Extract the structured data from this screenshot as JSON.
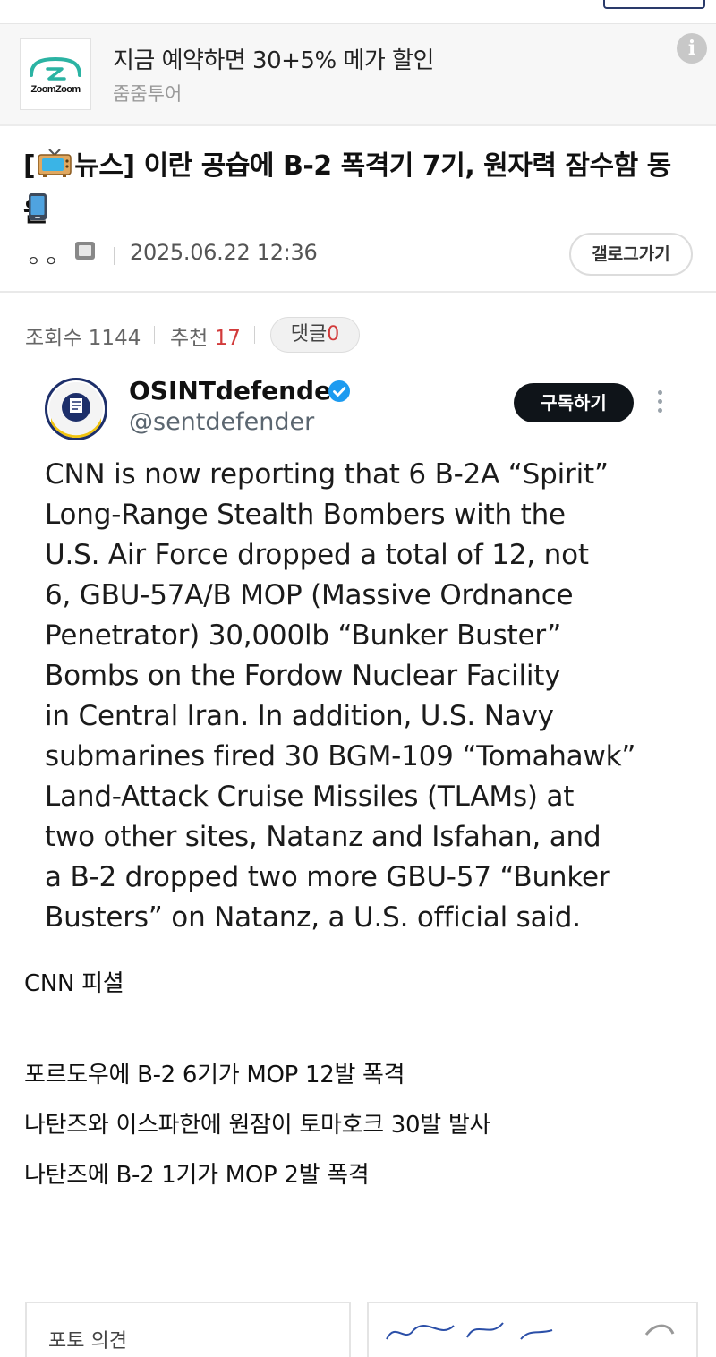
{
  "ad": {
    "logo_text": "ZoomZoom",
    "title": "지금 예약하면 30+5% 메가 할인",
    "sponsor": "줌줌투어",
    "info_icon": "i"
  },
  "post": {
    "title_prefix_open": "[",
    "title_category": "뉴스]",
    "title_text": " 이란 공습에 B-2 폭격기 7기, 원자력 잠수함 동원",
    "author": "ㅇ ㅇ",
    "date": "2025.06.22 12:36",
    "gallery_button": "갤로그가기",
    "views_label": "조회수",
    "views": "1144",
    "recommend_label": "추천",
    "recommend": "17",
    "comments_label": "댓글",
    "comments": "0"
  },
  "tweet": {
    "name": "OSINTdefender",
    "handle": "@sentdefender",
    "subscribe_label": "구독하기",
    "lines": [
      "CNN is now reporting that 6 B-2A “Spirit”",
      "Long-Range Stealth Bombers with the",
      "U.S. Air Force dropped a total of 12, not",
      "6, GBU-57A/B MOP (Massive Ordnance",
      "Penetrator) 30,000lb “Bunker Buster”",
      "Bombs on the Fordow Nuclear Facility",
      "in Central Iran. In addition, U.S. Navy",
      "submarines fired 30 BGM-109 “Tomahawk”",
      "Land-Attack Cruise Missiles (TLAMs) at",
      "two other sites, Natanz and Isfahan, and",
      "a B-2 dropped two more GBU-57 “Bunker",
      "Busters” on Natanz, a U.S. official said."
    ]
  },
  "article": {
    "source": "CNN 피셜",
    "summary1": "포르도우에 B-2 6기가 MOP 12발 폭격",
    "summary2": "나탄즈와 이스파한에 원잠이 토마호크 30발 발사",
    "summary3": "나탄즈에 B-2 1기가 MOP 2발 폭격"
  },
  "bottom": {
    "card_left_text": "포토 의견"
  },
  "colors": {
    "accent_red": "#d23b3b",
    "subscribe_bg": "#0f1419",
    "verified_blue": "#1d9bf0"
  },
  "icons": [
    "zoomzoom-logo-icon",
    "info-icon",
    "tv-icon",
    "mobile-phone-icon",
    "image-icon",
    "verified-badge-icon",
    "more-options-icon"
  ]
}
